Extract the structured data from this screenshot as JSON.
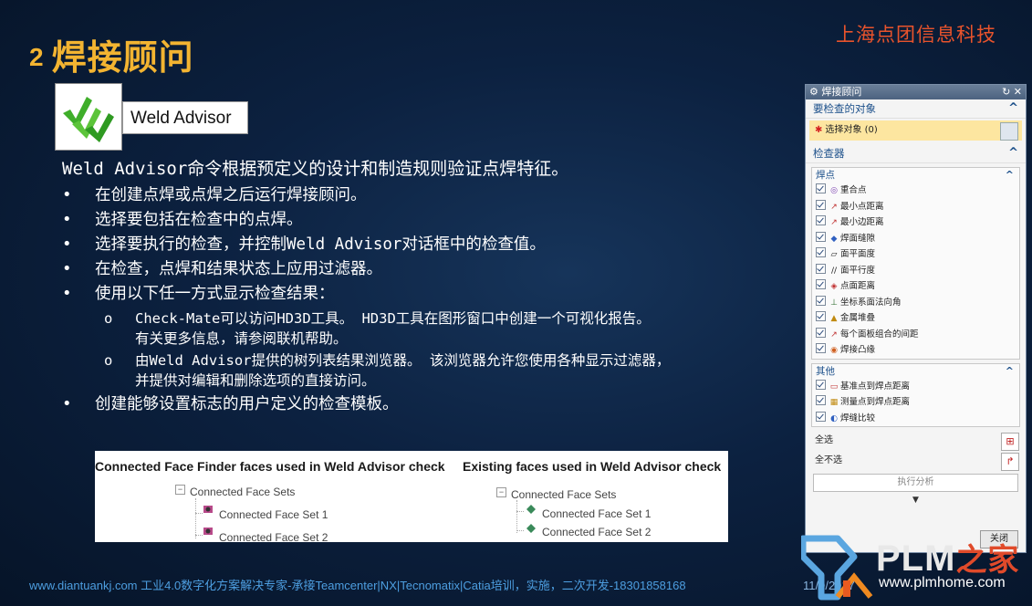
{
  "slide": {
    "title_num": "2",
    "title": "焊接顾问",
    "company": "上海点团信息科技",
    "logo_label": "Weld Advisor",
    "intro": "Weld Advisor命令根据预定义的设计和制造规则验证点焊特征。",
    "bullets": [
      "在创建点焊或点焊之后运行焊接顾问。",
      "选择要包括在检查中的点焊。",
      "选择要执行的检查，并控制Weld Advisor对话框中的检查值。",
      "在检查，点焊和结果状态上应用过滤器。",
      "使用以下任一方式显示检查结果："
    ],
    "sub_bullets": [
      {
        "line1": "Check-Mate可以访问HD3D工具。 HD3D工具在图形窗口中创建一个可视化报告。",
        "line2": "有关更多信息，请参阅联机帮助。"
      },
      {
        "line1": "由Weld Advisor提供的树列表结果浏览器。 该浏览器允许您使用各种显示过滤器，",
        "line2": "并提供对编辑和删除选项的直接访问。"
      }
    ],
    "last_bullet": "创建能够设置标志的用户定义的检查模板。",
    "bullet_glyph": "•",
    "sub_glyph": "o"
  },
  "tree_image": {
    "left_header": "Connected Face Finder faces used in Weld Advisor check",
    "right_header": "Existing faces used in Weld Advisor check",
    "left_root": "Connected Face Sets",
    "left_items": [
      "Connected Face Set 1",
      "Connected Face Set 2"
    ],
    "right_root": "Connected Face Sets",
    "right_items": [
      "Connected Face Set 1",
      "Connected Face Set 2"
    ]
  },
  "dialog": {
    "title": "焊接顾问",
    "section_objects": "要检查的对象",
    "select_label": "选择对象 (0)",
    "section_checkers": "检查器",
    "group_weld": "焊点",
    "weld_checks": [
      "重合点",
      "最小点距离",
      "最小边距离",
      "焊面缝隙",
      "面平面度",
      "面平行度",
      "点面距离",
      "坐标系面法向角",
      "金属堆叠",
      "每个面板组合的间距",
      "焊接凸缘"
    ],
    "group_other": "其他",
    "other_checks": [
      "基准点到焊点距离",
      "测量点到焊点距离",
      "焊缝比较"
    ],
    "select_all": "全选",
    "select_none": "全不选",
    "run_analysis": "执行分析",
    "close": "关闭"
  },
  "footer": {
    "text": "www.diantuankj.com 工业4.0数字化方案解决专家-承接Teamcenter|NX|Tecnomatix|Catia培训，实施，二次开发-18301858168",
    "date": "11/9/2017"
  },
  "brand": {
    "plm": "PLM",
    "cn": "之家",
    "url": "www.plmhome.com"
  },
  "colors": {
    "title": "#f3b431",
    "company": "#e8532c",
    "footer": "#4d9ee0",
    "accent_blue": "#1b4f8a"
  }
}
